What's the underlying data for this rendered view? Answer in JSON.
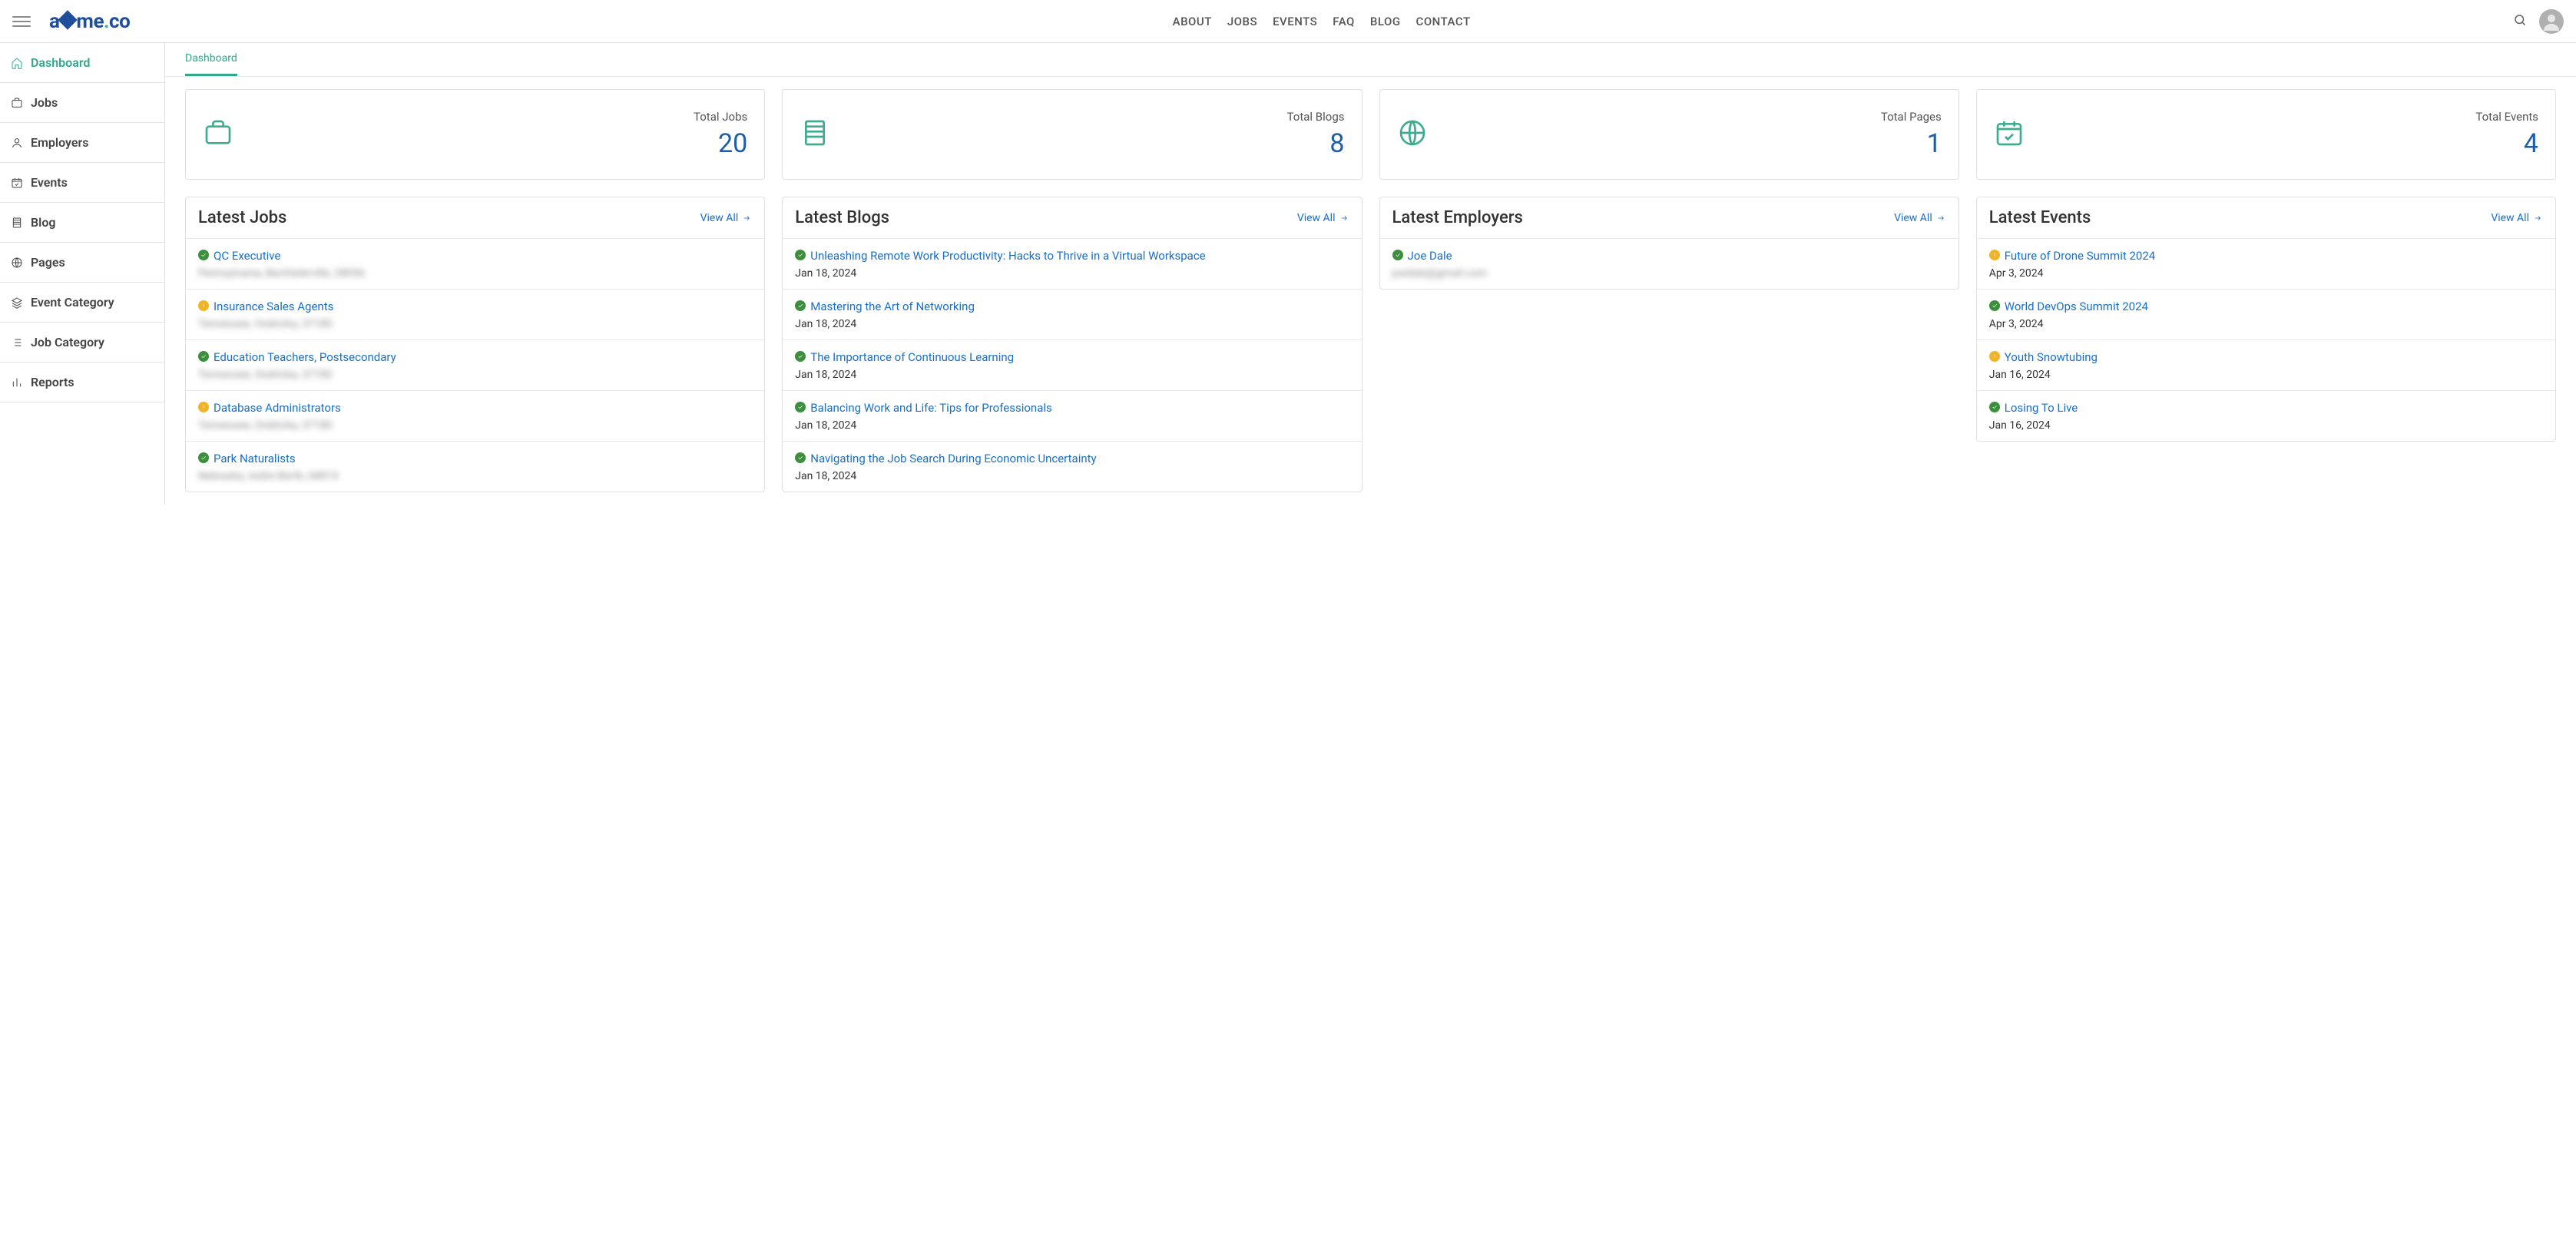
{
  "header": {
    "logo_text_pre": "a",
    "logo_text_post": "me",
    "logo_dot": ".",
    "logo_tld": "co",
    "nav": [
      "ABOUT",
      "JOBS",
      "EVENTS",
      "FAQ",
      "BLOG",
      "CONTACT"
    ]
  },
  "sidebar": {
    "items": [
      {
        "label": "Dashboard",
        "icon": "home",
        "active": true
      },
      {
        "label": "Jobs",
        "icon": "briefcase"
      },
      {
        "label": "Employers",
        "icon": "user"
      },
      {
        "label": "Events",
        "icon": "calendar-check"
      },
      {
        "label": "Blog",
        "icon": "book"
      },
      {
        "label": "Pages",
        "icon": "globe"
      },
      {
        "label": "Event Category",
        "icon": "layers"
      },
      {
        "label": "Job Category",
        "icon": "list"
      },
      {
        "label": "Reports",
        "icon": "bar-chart"
      }
    ]
  },
  "tab": "Dashboard",
  "view_all": "View All",
  "stats": [
    {
      "label": "Total Jobs",
      "value": "20",
      "icon": "briefcase"
    },
    {
      "label": "Total Blogs",
      "value": "8",
      "icon": "book"
    },
    {
      "label": "Total Pages",
      "value": "1",
      "icon": "globe"
    },
    {
      "label": "Total Events",
      "value": "4",
      "icon": "calendar-check"
    }
  ],
  "panels": {
    "jobs": {
      "title": "Latest Jobs",
      "items": [
        {
          "status": "ok",
          "title": "QC Executive",
          "sub_blur": "Pennsylvania, Bechtelerville, 38056"
        },
        {
          "status": "warn",
          "title": "Insurance Sales Agents",
          "sub_blur": "Tennessee, Ondricka, 37180"
        },
        {
          "status": "ok",
          "title": "Education Teachers, Postsecondary",
          "sub_blur": "Tennessee, Ondricka, 37180"
        },
        {
          "status": "warn",
          "title": "Database Administrators",
          "sub_blur": "Tennessee, Ondricka, 37180"
        },
        {
          "status": "ok",
          "title": "Park Naturalists",
          "sub_blur": "Nebraska, Isidre Berth, 68814"
        }
      ]
    },
    "blogs": {
      "title": "Latest Blogs",
      "items": [
        {
          "status": "ok",
          "title": "Unleashing Remote Work Productivity: Hacks to Thrive in a Virtual Workspace",
          "sub": "Jan 18, 2024"
        },
        {
          "status": "ok",
          "title": "Mastering the Art of Networking",
          "sub": "Jan 18, 2024"
        },
        {
          "status": "ok",
          "title": "The Importance of Continuous Learning",
          "sub": "Jan 18, 2024"
        },
        {
          "status": "ok",
          "title": "Balancing Work and Life: Tips for Professionals",
          "sub": "Jan 18, 2024"
        },
        {
          "status": "ok",
          "title": "Navigating the Job Search During Economic Uncertainty",
          "sub": "Jan 18, 2024"
        }
      ]
    },
    "employers": {
      "title": "Latest Employers",
      "items": [
        {
          "status": "ok",
          "title": "Joe Dale",
          "sub_blur": "joedale@gmail.com"
        }
      ]
    },
    "events": {
      "title": "Latest Events",
      "items": [
        {
          "status": "warn",
          "title": "Future of Drone Summit 2024",
          "sub": "Apr 3, 2024"
        },
        {
          "status": "ok",
          "title": "World DevOps Summit 2024",
          "sub": "Apr 3, 2024"
        },
        {
          "status": "warn",
          "title": "Youth Snowtubing",
          "sub": "Jan 16, 2024"
        },
        {
          "status": "ok",
          "title": "Losing To Live",
          "sub": "Jan 16, 2024"
        }
      ]
    }
  }
}
